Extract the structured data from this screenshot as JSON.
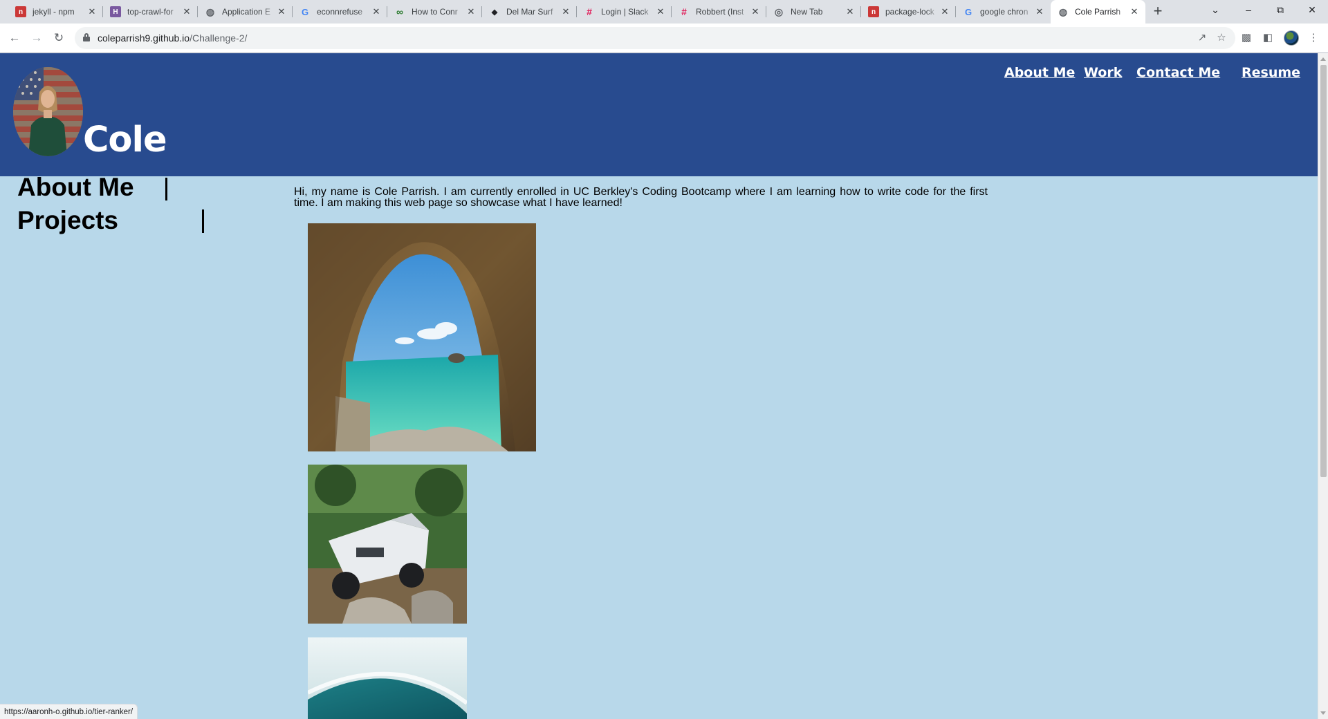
{
  "browser": {
    "tabs": [
      {
        "title": "jekyll - npm",
        "icon": "npm-icon",
        "color": "#cb3837"
      },
      {
        "title": "top-crawl-for",
        "icon": "heroku-icon",
        "color": "#79589f"
      },
      {
        "title": "Application E",
        "icon": "globe-icon",
        "color": "#5f6368"
      },
      {
        "title": "econnrefuse",
        "icon": "google-icon",
        "color": "#4285f4"
      },
      {
        "title": "How to Conr",
        "icon": "link-icon",
        "color": "#2e7d32"
      },
      {
        "title": "Del Mar Surf",
        "icon": "drop-icon",
        "color": "#202124"
      },
      {
        "title": "Login | Slack",
        "icon": "slack-icon",
        "color": "#e01e5a"
      },
      {
        "title": "Robbert (Inst",
        "icon": "slack-icon",
        "color": "#e01e5a"
      },
      {
        "title": "New Tab",
        "icon": "chrome-icon",
        "color": "#5f6368"
      },
      {
        "title": "package-lock",
        "icon": "npm-icon",
        "color": "#cb3837"
      },
      {
        "title": "google chron",
        "icon": "google-icon",
        "color": "#4285f4"
      },
      {
        "title": "Cole Parrish",
        "icon": "globe-icon",
        "color": "#5f6368",
        "active": true
      }
    ],
    "url_host": "coleparrish9.github.io",
    "url_path": "/Challenge-2/",
    "status_url": "https://aaronh-o.github.io/tier-ranker/"
  },
  "site": {
    "name": "Cole",
    "nav": [
      "About Me",
      "Work",
      "Contact Me",
      "Resume"
    ],
    "sidebar": [
      "About Me",
      "Projects"
    ],
    "intro": "Hi, my name is Cole Parrish. I am currently enrolled in UC Berkley's Coding Bootcamp where I am learning how to write code for the first time. I am making this web page so showcase what I have learned!",
    "colors": {
      "header": "#284b8f",
      "background": "#b8d8ea"
    }
  }
}
